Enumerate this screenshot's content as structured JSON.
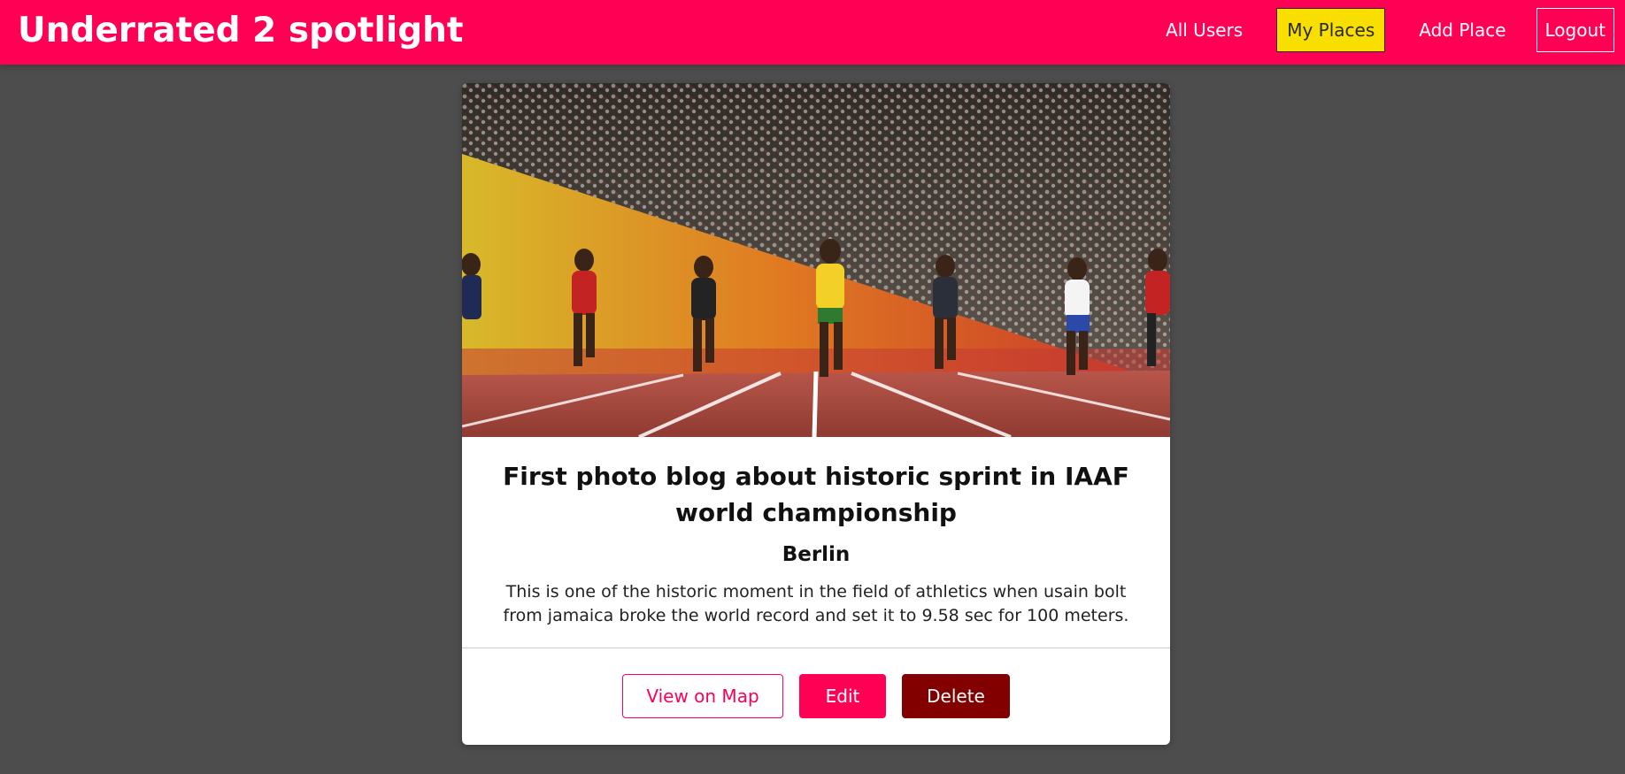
{
  "header": {
    "brand": "Underrated 2 spotlight",
    "nav": [
      {
        "label": "All Users",
        "active": false
      },
      {
        "label": "My Places",
        "active": true
      },
      {
        "label": "Add Place",
        "active": false
      },
      {
        "label": "Logout",
        "active": false
      }
    ]
  },
  "place": {
    "image_alt": "Sprinters racing on a stadium track",
    "title": "First photo blog about historic sprint in IAAF world championship",
    "address": "Berlin",
    "description": "This is one of the historic moment in the field of athletics when usain bolt from jamaica broke the world record and set it to 9.58 sec for 100 meters.",
    "actions": {
      "view_map": "View on Map",
      "edit": "Edit",
      "delete": "Delete"
    }
  },
  "colors": {
    "header_bg": "#ff0055",
    "active_nav_bg": "#f8df00",
    "page_bg": "#4d4d4d",
    "delete_bg": "#830000"
  }
}
